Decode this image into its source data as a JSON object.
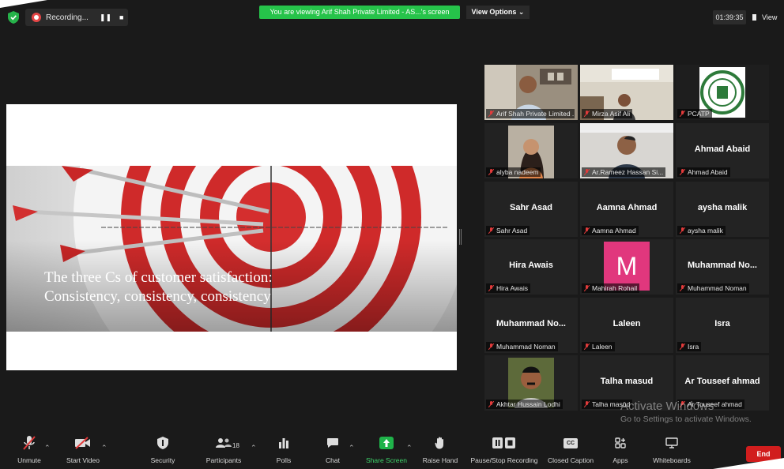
{
  "top": {
    "recording_label": "Recording...",
    "pause_glyph": "❚❚",
    "stop_glyph": "■",
    "banner": "You are viewing Arif Shah Private Limited - AS...'s screen",
    "view_options": "View Options ⌄",
    "timer": "01:39:35",
    "view_label": "View"
  },
  "slide": {
    "line1": "The three Cs of customer satisfaction:",
    "line2": "Consistency, consistency, consistency"
  },
  "participants": [
    {
      "label": "Arif Shah Private Limited ...",
      "big": "",
      "type": "photo-office",
      "active": true
    },
    {
      "label": "Mirza Asif Ali",
      "big": "",
      "type": "photo-room"
    },
    {
      "label": "PCATP",
      "big": "",
      "type": "logo"
    },
    {
      "label": "alyba nadeem",
      "big": "",
      "type": "photo-woman"
    },
    {
      "label": "Ar.Rameez Hassan Si...",
      "big": "",
      "type": "photo-man"
    },
    {
      "label": "Ahmad Abaid",
      "big": "Ahmad Abaid",
      "type": "text"
    },
    {
      "label": "Sahr Asad",
      "big": "Sahr Asad",
      "type": "text"
    },
    {
      "label": "Aamna Ahmad",
      "big": "Aamna Ahmad",
      "type": "text"
    },
    {
      "label": "aysha malik",
      "big": "aysha malik",
      "type": "text"
    },
    {
      "label": "Hira Awais",
      "big": "Hira Awais",
      "type": "text"
    },
    {
      "label": "Mahirah Rohail",
      "big": "M",
      "type": "avatar"
    },
    {
      "label": "Muhammad Noman",
      "big": "Muhammad No...",
      "type": "text"
    },
    {
      "label": "Muhammad Noman",
      "big": "Muhammad No...",
      "type": "text"
    },
    {
      "label": "Laleen",
      "big": "Laleen",
      "type": "text"
    },
    {
      "label": "Isra",
      "big": "Isra",
      "type": "text"
    },
    {
      "label": "Akhtar Hussain Lodhi",
      "big": "",
      "type": "photo-lodhi"
    },
    {
      "label": "Talha masud",
      "big": "Talha masud",
      "type": "text"
    },
    {
      "label": "Ar Touseef ahmad",
      "big": "Ar Touseef ahmad",
      "type": "text"
    }
  ],
  "watermark": {
    "line1": "Activate Windows",
    "line2": "Go to Settings to activate Windows."
  },
  "toolbar": {
    "unmute": "Unmute",
    "start_video": "Start Video",
    "security": "Security",
    "participants": "Participants",
    "participant_count": "18",
    "polls": "Polls",
    "chat": "Chat",
    "share_screen": "Share Screen",
    "raise_hand": "Raise Hand",
    "pause_stop": "Pause/Stop Recording",
    "closed_caption": "Closed Caption",
    "cc_glyph": "CC",
    "apps": "Apps",
    "whiteboards": "Whiteboards",
    "end": "End"
  },
  "colors": {
    "banner": "#26c34a",
    "active_border": "#d6e36a",
    "end_button": "#d11d1d",
    "avatar_bg": "#e1377d",
    "share_green": "#1fb34a",
    "muted_red": "#e23b3b"
  }
}
